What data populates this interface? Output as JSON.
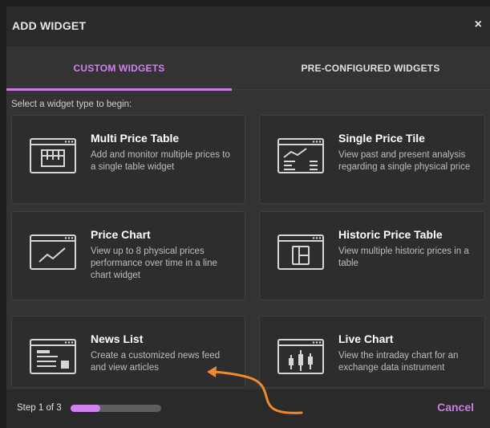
{
  "dialog": {
    "title": "ADD WIDGET",
    "close_glyph": "×"
  },
  "tabs": [
    {
      "label": "CUSTOM WIDGETS",
      "active": true
    },
    {
      "label": "PRE-CONFIGURED WIDGETS",
      "active": false
    }
  ],
  "instruction": "Select a widget type to begin:",
  "widgets": [
    {
      "title": "Multi Price Table",
      "description": "Add and monitor multiple prices to a single table widget",
      "icon": "table-icon"
    },
    {
      "title": "Single Price Tile",
      "description": "View past and present analysis regarding a single physical price",
      "icon": "tile-chart-icon"
    },
    {
      "title": "Price Chart",
      "description": "View up to 8 physical prices performance over time in a line chart widget",
      "icon": "line-chart-icon"
    },
    {
      "title": "Historic Price Table",
      "description": "View multiple historic prices in a table",
      "icon": "historic-table-icon"
    },
    {
      "title": "News List",
      "description": "Create a customized news feed and view articles",
      "icon": "news-icon"
    },
    {
      "title": "Live Chart",
      "description": "View the intraday chart for an exchange data instrument",
      "icon": "candlestick-icon"
    }
  ],
  "footer": {
    "step_label": "Step 1 of 3",
    "progress": 0.33,
    "cancel_label": "Cancel"
  },
  "colors": {
    "accent": "#c97ee6",
    "annotation_arrow": "#f08a2e"
  }
}
